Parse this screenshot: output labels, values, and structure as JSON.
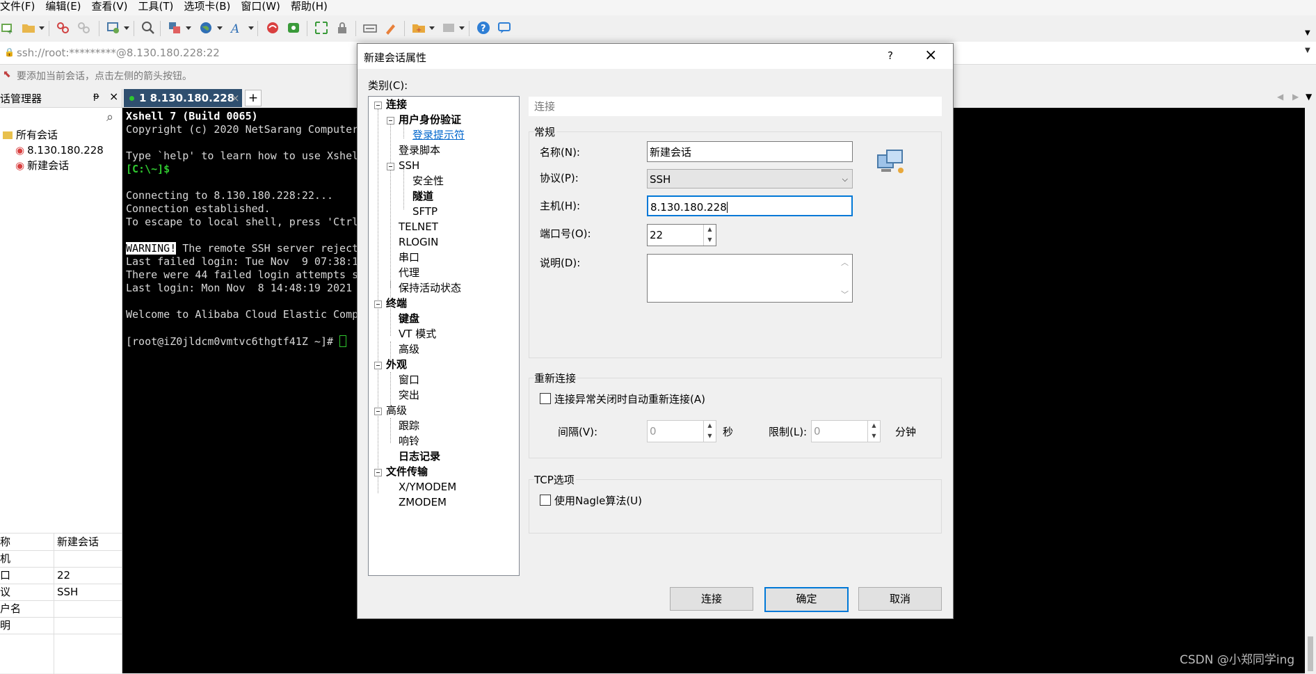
{
  "menu": {
    "items": [
      "文件(F)",
      "编辑(E)",
      "查看(V)",
      "工具(T)",
      "选项卡(B)",
      "窗口(W)",
      "帮助(H)"
    ]
  },
  "address_bar": {
    "text": "ssh://root:*********@8.130.180.228:22"
  },
  "hint_bar": {
    "text": "要添加当前会话，点击左侧的箭头按钮。"
  },
  "session_manager": {
    "title": "话管理器",
    "pin_glyph": "ᵽ",
    "close_glyph": "×",
    "search_glyph": "⌕",
    "root": "所有会话",
    "sessions": [
      "8.130.180.228",
      "新建会话"
    ]
  },
  "properties": [
    {
      "key": "称",
      "value": "新建会话"
    },
    {
      "key": "机",
      "value": ""
    },
    {
      "key": "口",
      "value": "22"
    },
    {
      "key": "议",
      "value": "SSH"
    },
    {
      "key": "户名",
      "value": ""
    },
    {
      "key": "明",
      "value": ""
    }
  ],
  "tabs": {
    "active_label": "1 8.130.180.228",
    "close_glyph": "×",
    "add_glyph": "+"
  },
  "terminal": {
    "lines": [
      "Xshell 7 (Build 0065)",
      "Copyright (c) 2020 NetSarang Computer",
      "",
      "Type `help' to learn how to use Xshel",
      "[C:\\~]$",
      "",
      "Connecting to 8.130.180.228:22...",
      "Connection established.",
      "To escape to local shell, press 'Ctrl",
      "",
      "WARNING! The remote SSH server reject",
      "Last failed login: Tue Nov  9 07:38:1",
      "There were 44 failed login attempts s",
      "Last login: Mon Nov  8 14:48:19 2021",
      "",
      "Welcome to Alibaba Cloud Elastic Comp",
      "",
      "[root@iZ0jldcm0vmtvc6thgtf41Z ~]# "
    ],
    "warning_word": "WARNING!",
    "warning_rest": " The remote SSH server reject",
    "prompt_local": "[C:\\~]$",
    "prompt": "[root@iZ0jldcm0vmtvc6thgtf41Z ~]# "
  },
  "dialog": {
    "title": "新建会话属性",
    "help_glyph": "?",
    "close_glyph": "×",
    "category_label": "类别(C):",
    "tree": [
      {
        "label": "连接",
        "level": 0,
        "bold": true
      },
      {
        "label": "用户身份验证",
        "level": 1,
        "bold": true
      },
      {
        "label": "登录提示符",
        "level": 2,
        "selected": true
      },
      {
        "label": "登录脚本",
        "level": 1
      },
      {
        "label": "SSH",
        "level": 1
      },
      {
        "label": "安全性",
        "level": 2
      },
      {
        "label": "隧道",
        "level": 2,
        "bold": true
      },
      {
        "label": "SFTP",
        "level": 2
      },
      {
        "label": "TELNET",
        "level": 1
      },
      {
        "label": "RLOGIN",
        "level": 1
      },
      {
        "label": "串口",
        "level": 1
      },
      {
        "label": "代理",
        "level": 1
      },
      {
        "label": "保持活动状态",
        "level": 1
      },
      {
        "label": "终端",
        "level": 0,
        "bold": true
      },
      {
        "label": "键盘",
        "level": 1,
        "bold": true
      },
      {
        "label": "VT 模式",
        "level": 1
      },
      {
        "label": "高级",
        "level": 1
      },
      {
        "label": "外观",
        "level": 0,
        "bold": true
      },
      {
        "label": "窗口",
        "level": 1
      },
      {
        "label": "突出",
        "level": 1
      },
      {
        "label": "高级",
        "level": 0
      },
      {
        "label": "跟踪",
        "level": 1
      },
      {
        "label": "响铃",
        "level": 1
      },
      {
        "label": "日志记录",
        "level": 1,
        "bold": true
      },
      {
        "label": "文件传输",
        "level": 0,
        "bold": true
      },
      {
        "label": "X/YMODEM",
        "level": 1
      },
      {
        "label": "ZMODEM",
        "level": 1
      }
    ],
    "section_header": "连接",
    "general": {
      "title": "常规",
      "name_label": "名称(N):",
      "name_value": "新建会话",
      "protocol_label": "协议(P):",
      "protocol_value": "SSH",
      "host_label": "主机(H):",
      "host_value": "8.130.180.228",
      "port_label": "端口号(O):",
      "port_value": "22",
      "desc_label": "说明(D):",
      "desc_value": ""
    },
    "reconnect": {
      "title": "重新连接",
      "auto_label": "连接异常关闭时自动重新连接(A)",
      "interval_label": "间隔(V):",
      "interval_value": "0",
      "interval_unit": "秒",
      "limit_label": "限制(L):",
      "limit_value": "0",
      "limit_unit": "分钟"
    },
    "tcp": {
      "title": "TCP选项",
      "nagle_label": "使用Nagle算法(U)"
    },
    "buttons": {
      "connect": "连接",
      "ok": "确定",
      "cancel": "取消"
    }
  },
  "watermark": "CSDN @小郑同学ing",
  "colors": {
    "terminal_bg": "#000000",
    "tab_active": "#2f4f6f",
    "link_blue": "#0066cc",
    "prompt_green": "#2fc72f",
    "ok_border": "#0078d7"
  }
}
